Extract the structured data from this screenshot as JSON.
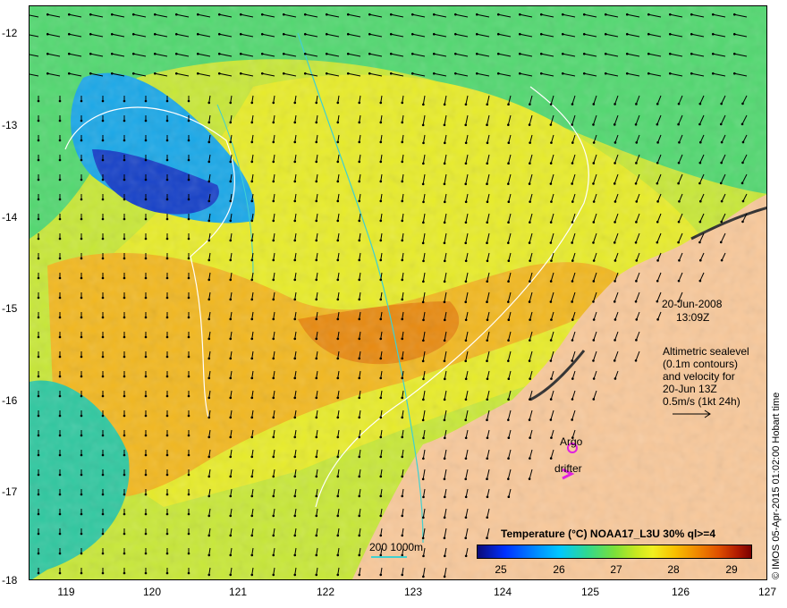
{
  "map": {
    "y_ticks": [
      "-12",
      "-13",
      "-14",
      "-15",
      "-16",
      "-17",
      "-18"
    ],
    "x_ticks": [
      "119",
      "120",
      "121",
      "122",
      "123",
      "124",
      "125",
      "126",
      "127"
    ],
    "date": "20-Jun-2008",
    "time": "13:09Z",
    "info_lines": [
      "Altimetric sealevel",
      "(0.1m contours)",
      "and velocity for",
      "20-Jun 13Z",
      "0.5m/s (1kt 24h)"
    ],
    "argo_label": "Argo",
    "drifter_label": "drifter",
    "scale_label": "200  1000m",
    "credit": "© IMOS 05-Apr-2015 01:02:00 Hobart time",
    "legend_title": "Temperature (°C) NOAA17_L3U 30% ql>=4",
    "colorbar_ticks": [
      "25",
      "26",
      "27",
      "28",
      "29"
    ],
    "colors": {
      "land": "#f8c89a",
      "argo": "#e020e0",
      "drifter": "#e020e0",
      "isobath": "#40d0d0"
    }
  }
}
